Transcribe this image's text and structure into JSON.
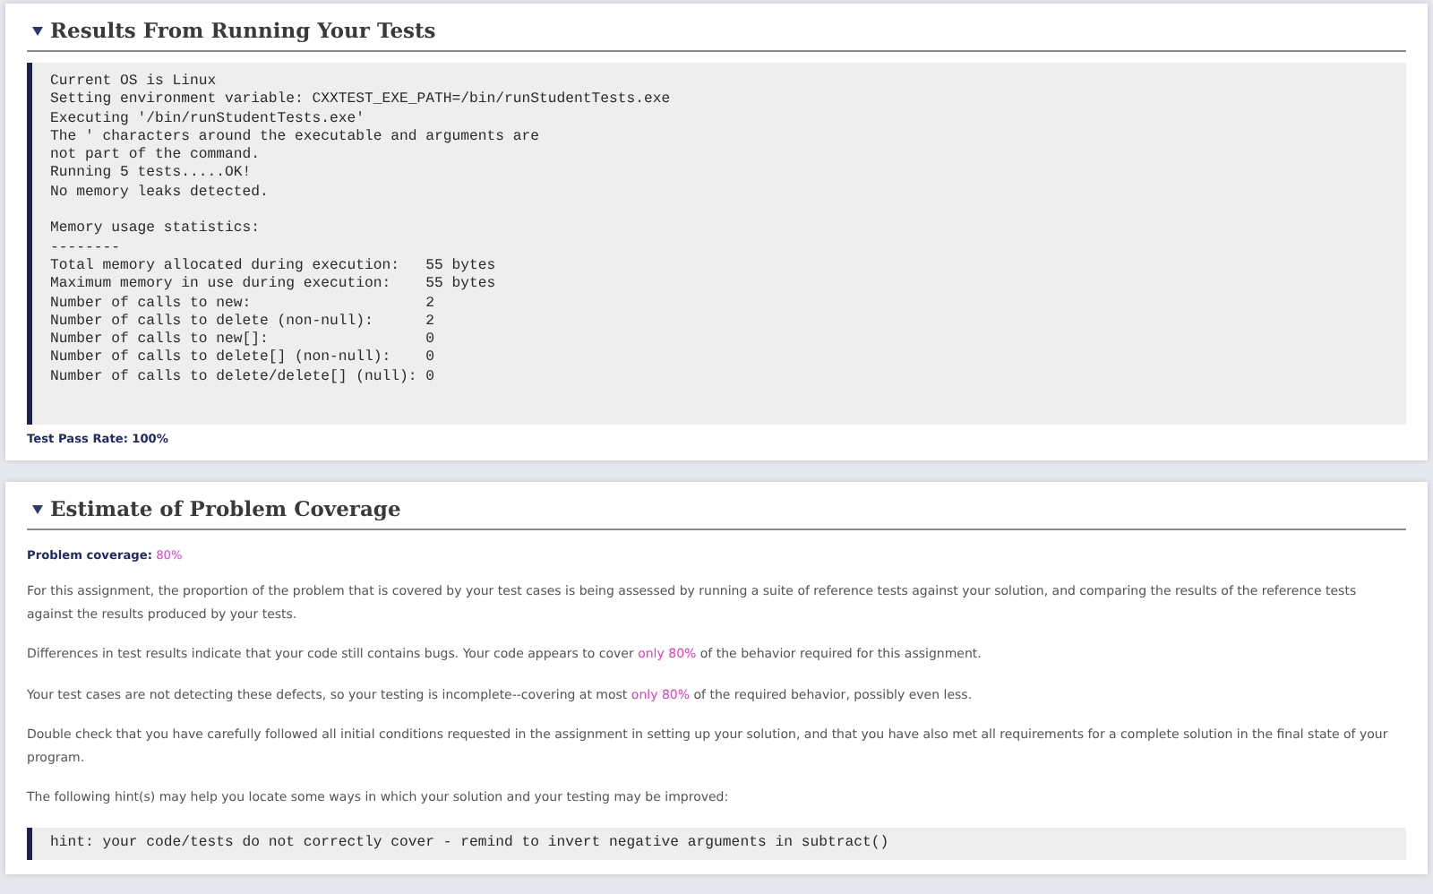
{
  "sections": [
    {
      "title": "Results From Running Your Tests",
      "expanded": true,
      "blocks": [
        {
          "kind": "code",
          "text": "Current OS is Linux\nSetting environment variable: CXXTEST_EXE_PATH=/bin/runStudentTests.exe\nExecuting '/bin/runStudentTests.exe'\nThe ' characters around the executable and arguments are\nnot part of the command.\nRunning 5 tests.....OK!\nNo memory leaks detected.\n\nMemory usage statistics:\n--------\nTotal memory allocated during execution:   55 bytes\nMaximum memory in use during execution:    55 bytes\nNumber of calls to new:                    2\nNumber of calls to delete (non-null):      2\nNumber of calls to new[]:                  0\nNumber of calls to delete[] (non-null):    0\nNumber of calls to delete/delete[] (null): 0"
        },
        {
          "kind": "stat",
          "label": "Test Pass Rate:",
          "value": "100%"
        }
      ]
    },
    {
      "title": "Estimate of Problem Coverage",
      "expanded": true,
      "blocks": [
        {
          "kind": "stat",
          "label": "Problem coverage:",
          "value": "80%",
          "highlight": true
        },
        {
          "kind": "paragraph",
          "parts": [
            {
              "text": "For this assignment, the proportion of the problem that is covered by your test cases is being assessed by running a suite of reference tests against your solution, and comparing the results of the reference tests against the results produced by your tests.",
              "highlight": false
            }
          ]
        },
        {
          "kind": "paragraph",
          "parts": [
            {
              "text": "Differences in test results indicate that your code still contains bugs. Your code appears to cover ",
              "highlight": false
            },
            {
              "text": "only 80%",
              "highlight": true
            },
            {
              "text": " of the behavior required for this assignment.",
              "highlight": false
            }
          ]
        },
        {
          "kind": "paragraph",
          "parts": [
            {
              "text": "Your test cases are not detecting these defects, so your testing is incomplete--covering at most ",
              "highlight": false
            },
            {
              "text": "only 80%",
              "highlight": true
            },
            {
              "text": " of the required behavior, possibly even less.",
              "highlight": false
            }
          ]
        },
        {
          "kind": "paragraph",
          "parts": [
            {
              "text": "Double check that you have carefully followed all initial conditions requested in the assignment in setting up your solution, and that you have also met all requirements for a complete solution in the final state of your program.",
              "highlight": false
            }
          ]
        },
        {
          "kind": "paragraph",
          "parts": [
            {
              "text": "The following hint(s) may help you locate some ways in which your solution and your testing may be improved:",
              "highlight": false
            }
          ]
        },
        {
          "kind": "code",
          "text": "hint: your code/tests do not correctly cover - remind to invert negative arguments in subtract()"
        }
      ]
    }
  ]
}
